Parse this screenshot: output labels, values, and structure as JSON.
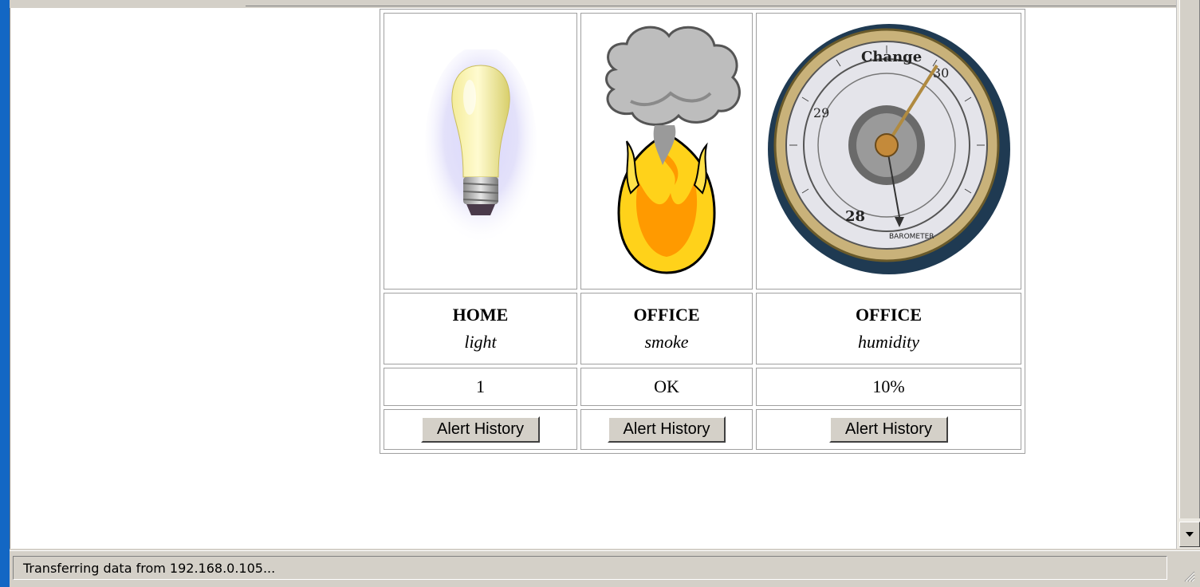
{
  "status_bar": {
    "text": "Transferring data from 192.168.0.105..."
  },
  "sensors": [
    {
      "location": "HOME",
      "type": "light",
      "value": "1",
      "button": "Alert History",
      "icon": "light-bulb-icon"
    },
    {
      "location": "OFFICE",
      "type": "smoke",
      "value": "OK",
      "button": "Alert History",
      "icon": "smoke-fire-icon"
    },
    {
      "location": "OFFICE",
      "type": "humidity",
      "value": "10%",
      "button": "Alert History",
      "icon": "barometer-icon"
    }
  ],
  "barometer_dial": {
    "top_label": "Change",
    "number_left": "29",
    "number_right": "30",
    "number_bottom": "28",
    "maker": "BAROMETER"
  }
}
